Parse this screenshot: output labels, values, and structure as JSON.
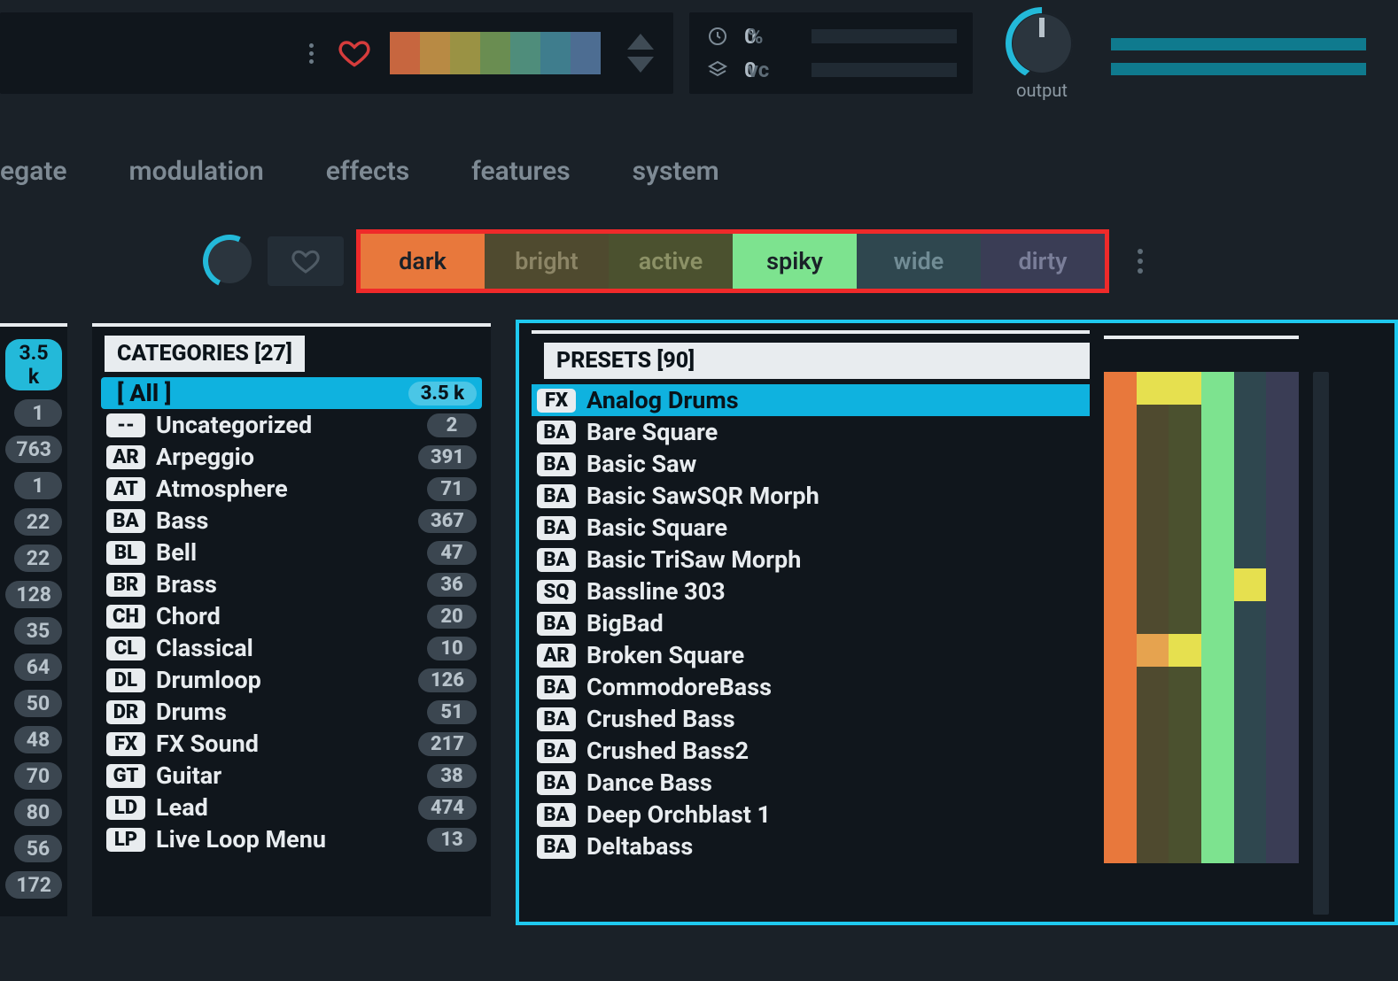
{
  "top": {
    "strip_colors": [
      "#c7663f",
      "#b88a44",
      "#9a9244",
      "#6a8d51",
      "#4f8d7b",
      "#3f7d8d",
      "#4d6d92"
    ],
    "cpu": {
      "value": "0",
      "suffix": "%"
    },
    "voices": {
      "value": "0",
      "suffix": "vc"
    },
    "output_label": "output"
  },
  "nav": [
    "egate",
    "modulation",
    "effects",
    "features",
    "system"
  ],
  "tags": [
    {
      "key": "dark",
      "label": "dark",
      "cls": "tag-dark"
    },
    {
      "key": "bright",
      "label": "bright",
      "cls": "tag-bright"
    },
    {
      "key": "active",
      "label": "active",
      "cls": "tag-active"
    },
    {
      "key": "spiky",
      "label": "spiky",
      "cls": "tag-spiky"
    },
    {
      "key": "wide",
      "label": "wide",
      "cls": "tag-wide"
    },
    {
      "key": "dirty",
      "label": "dirty",
      "cls": "tag-dirty"
    }
  ],
  "left_counts": [
    "3.5 k",
    "1",
    "763",
    "1",
    "22",
    "22",
    "128",
    "35",
    "64",
    "50",
    "48",
    "70",
    "80",
    "56",
    "172"
  ],
  "categories_header": "CATEGORIES [27]",
  "categories": [
    {
      "code": "",
      "label": "[ All ]",
      "count": "3.5 k",
      "selected": true
    },
    {
      "code": "--",
      "label": "Uncategorized",
      "count": "2"
    },
    {
      "code": "AR",
      "label": "Arpeggio",
      "count": "391"
    },
    {
      "code": "AT",
      "label": "Atmosphere",
      "count": "71"
    },
    {
      "code": "BA",
      "label": "Bass",
      "count": "367"
    },
    {
      "code": "BL",
      "label": "Bell",
      "count": "47"
    },
    {
      "code": "BR",
      "label": "Brass",
      "count": "36"
    },
    {
      "code": "CH",
      "label": "Chord",
      "count": "20"
    },
    {
      "code": "CL",
      "label": "Classical",
      "count": "10"
    },
    {
      "code": "DL",
      "label": "Drumloop",
      "count": "126"
    },
    {
      "code": "DR",
      "label": "Drums",
      "count": "51"
    },
    {
      "code": "FX",
      "label": "FX Sound",
      "count": "217"
    },
    {
      "code": "GT",
      "label": "Guitar",
      "count": "38"
    },
    {
      "code": "LD",
      "label": "Lead",
      "count": "474"
    },
    {
      "code": "LP",
      "label": "Live Loop Menu",
      "count": "13"
    }
  ],
  "presets_header": "PRESETS [90]",
  "presets": [
    {
      "code": "FX",
      "label": "Analog Drums",
      "selected": true
    },
    {
      "code": "BA",
      "label": "Bare Square"
    },
    {
      "code": "BA",
      "label": "Basic Saw"
    },
    {
      "code": "BA",
      "label": "Basic SawSQR Morph"
    },
    {
      "code": "BA",
      "label": "Basic Square"
    },
    {
      "code": "BA",
      "label": "Basic TriSaw Morph"
    },
    {
      "code": "SQ",
      "label": "Bassline 303"
    },
    {
      "code": "BA",
      "label": "BigBad"
    },
    {
      "code": "AR",
      "label": "Broken Square"
    },
    {
      "code": "BA",
      "label": "CommodoreBass"
    },
    {
      "code": "BA",
      "label": "Crushed Bass"
    },
    {
      "code": "BA",
      "label": "Crushed Bass2"
    },
    {
      "code": "BA",
      "label": "Dance Bass"
    },
    {
      "code": "BA",
      "label": "Deep Orchblast 1"
    },
    {
      "code": "BA",
      "label": "Deltabass"
    }
  ],
  "grid_palette": {
    "c1": "#e8783c",
    "c2": "#4f4a2f",
    "c3": "#4b512f",
    "c4": "#7de38f",
    "c5": "#2f474f",
    "c6": "#3a3d55",
    "y": "#e6e04f",
    "o": "#e6a34f"
  },
  "grid_rows": [
    [
      "c1",
      "y",
      "y",
      "c4",
      "c5",
      "c6"
    ],
    [
      "c1",
      "c2",
      "c3",
      "c4",
      "c5",
      "c6"
    ],
    [
      "c1",
      "c2",
      "c3",
      "c4",
      "c5",
      "c6"
    ],
    [
      "c1",
      "c2",
      "c3",
      "c4",
      "c5",
      "c6"
    ],
    [
      "c1",
      "c2",
      "c3",
      "c4",
      "c5",
      "c6"
    ],
    [
      "c1",
      "c2",
      "c3",
      "c4",
      "c5",
      "c6"
    ],
    [
      "c1",
      "c2",
      "c3",
      "c4",
      "y",
      "c6"
    ],
    [
      "c1",
      "c2",
      "c3",
      "c4",
      "c5",
      "c6"
    ],
    [
      "c1",
      "o",
      "y",
      "c4",
      "c5",
      "c6"
    ],
    [
      "c1",
      "c2",
      "c3",
      "c4",
      "c5",
      "c6"
    ],
    [
      "c1",
      "c2",
      "c3",
      "c4",
      "c5",
      "c6"
    ],
    [
      "c1",
      "c2",
      "c3",
      "c4",
      "c5",
      "c6"
    ],
    [
      "c1",
      "c2",
      "c3",
      "c4",
      "c5",
      "c6"
    ],
    [
      "c1",
      "c2",
      "c3",
      "c4",
      "c5",
      "c6"
    ],
    [
      "c1",
      "c2",
      "c3",
      "c4",
      "c5",
      "c6"
    ]
  ]
}
